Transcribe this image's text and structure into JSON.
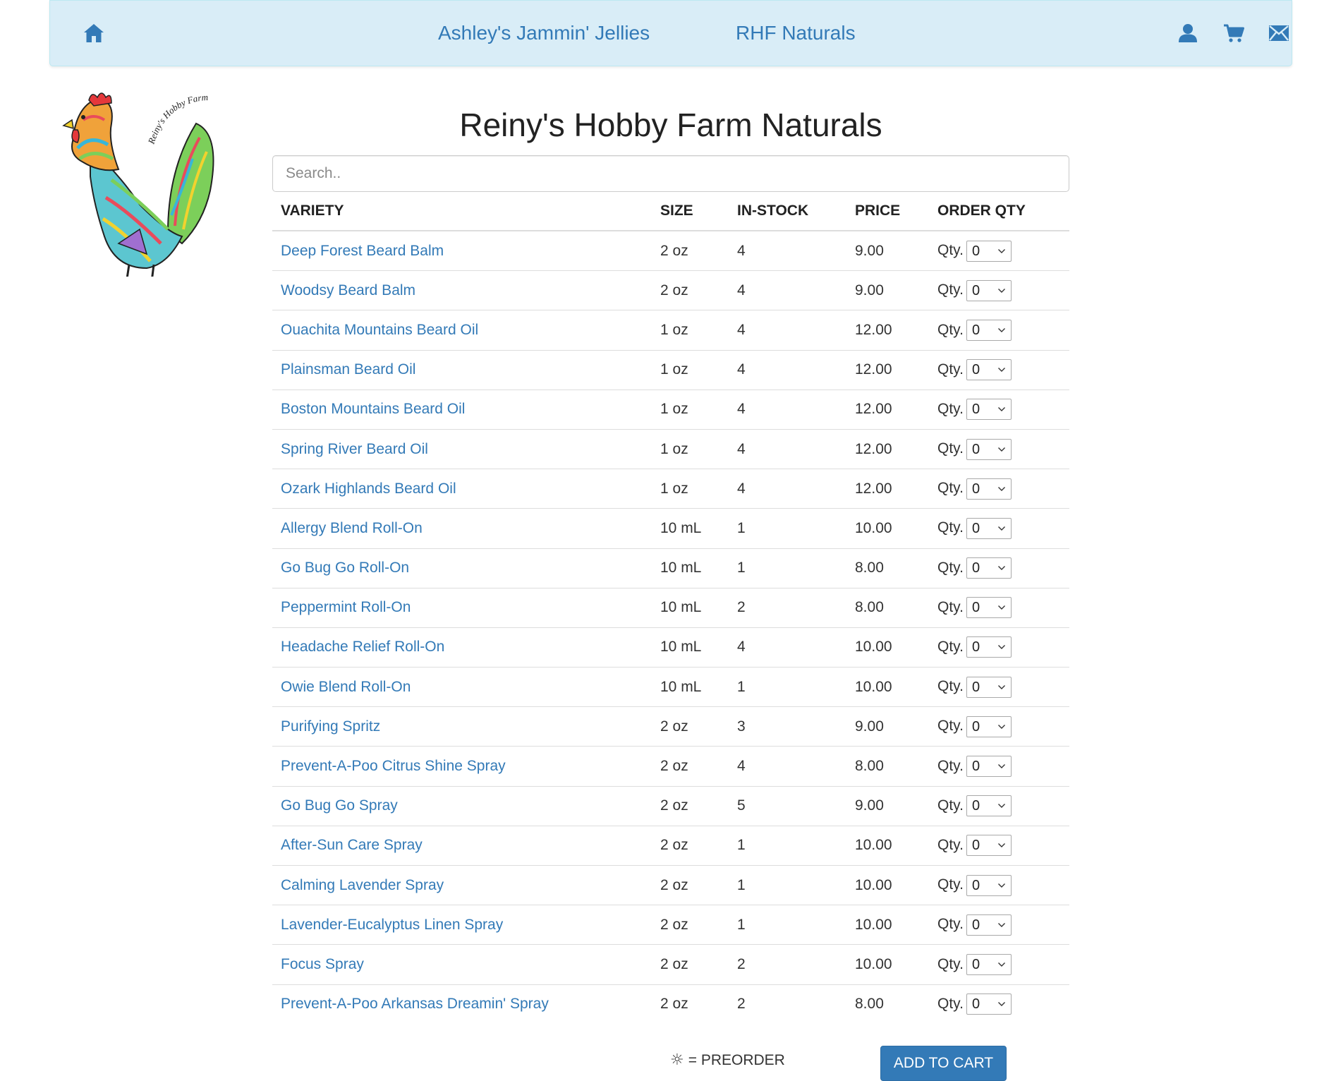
{
  "nav": {
    "home_icon": "home-icon",
    "links": [
      "Ashley's Jammin' Jellies",
      "RHF Naturals"
    ],
    "user_icon": "user-icon",
    "cart_icon": "cart-icon",
    "mail_icon": "mail-icon"
  },
  "logo": {
    "text": "Reiny's Hobby Farm"
  },
  "page": {
    "title": "Reiny's Hobby Farm Naturals"
  },
  "search": {
    "placeholder": "Search..",
    "value": ""
  },
  "table": {
    "headers": [
      "VARIETY",
      "SIZE",
      "IN-STOCK",
      "PRICE",
      "ORDER QTY"
    ],
    "qty_label": "Qty.",
    "rows": [
      {
        "variety": "Deep Forest Beard Balm",
        "size": "2 oz",
        "stock": "4",
        "price": "9.00",
        "qty": "0"
      },
      {
        "variety": "Woodsy Beard Balm",
        "size": "2 oz",
        "stock": "4",
        "price": "9.00",
        "qty": "0"
      },
      {
        "variety": "Ouachita Mountains Beard Oil",
        "size": "1 oz",
        "stock": "4",
        "price": "12.00",
        "qty": "0"
      },
      {
        "variety": "Plainsman Beard Oil",
        "size": "1 oz",
        "stock": "4",
        "price": "12.00",
        "qty": "0"
      },
      {
        "variety": "Boston Mountains Beard Oil",
        "size": "1 oz",
        "stock": "4",
        "price": "12.00",
        "qty": "0"
      },
      {
        "variety": "Spring River Beard Oil",
        "size": "1 oz",
        "stock": "4",
        "price": "12.00",
        "qty": "0"
      },
      {
        "variety": "Ozark Highlands Beard Oil",
        "size": "1 oz",
        "stock": "4",
        "price": "12.00",
        "qty": "0"
      },
      {
        "variety": "Allergy Blend Roll-On",
        "size": "10 mL",
        "stock": "1",
        "price": "10.00",
        "qty": "0"
      },
      {
        "variety": "Go Bug Go Roll-On",
        "size": "10 mL",
        "stock": "1",
        "price": "8.00",
        "qty": "0"
      },
      {
        "variety": "Peppermint Roll-On",
        "size": "10 mL",
        "stock": "2",
        "price": "8.00",
        "qty": "0"
      },
      {
        "variety": "Headache Relief Roll-On",
        "size": "10 mL",
        "stock": "4",
        "price": "10.00",
        "qty": "0"
      },
      {
        "variety": "Owie Blend Roll-On",
        "size": "10 mL",
        "stock": "1",
        "price": "10.00",
        "qty": "0"
      },
      {
        "variety": "Purifying Spritz",
        "size": "2 oz",
        "stock": "3",
        "price": "9.00",
        "qty": "0"
      },
      {
        "variety": "Prevent-A-Poo Citrus Shine Spray",
        "size": "2 oz",
        "stock": "4",
        "price": "8.00",
        "qty": "0"
      },
      {
        "variety": "Go Bug Go Spray",
        "size": "2 oz",
        "stock": "5",
        "price": "9.00",
        "qty": "0"
      },
      {
        "variety": "After-Sun Care Spray",
        "size": "2 oz",
        "stock": "1",
        "price": "10.00",
        "qty": "0"
      },
      {
        "variety": "Calming Lavender Spray",
        "size": "2 oz",
        "stock": "1",
        "price": "10.00",
        "qty": "0"
      },
      {
        "variety": "Lavender-Eucalyptus Linen Spray",
        "size": "2 oz",
        "stock": "1",
        "price": "10.00",
        "qty": "0"
      },
      {
        "variety": "Focus Spray",
        "size": "2 oz",
        "stock": "2",
        "price": "10.00",
        "qty": "0"
      },
      {
        "variety": "Prevent-A-Poo Arkansas Dreamin' Spray",
        "size": "2 oz",
        "stock": "2",
        "price": "8.00",
        "qty": "0"
      }
    ]
  },
  "footer": {
    "legend_icon": "sun-icon",
    "legend_symbol": "☼",
    "legend_text": "= PREORDER",
    "add_to_cart": "ADD TO CART"
  },
  "colors": {
    "navbar_bg": "#d9edf7",
    "link": "#337ab7",
    "button": "#337ab7"
  }
}
